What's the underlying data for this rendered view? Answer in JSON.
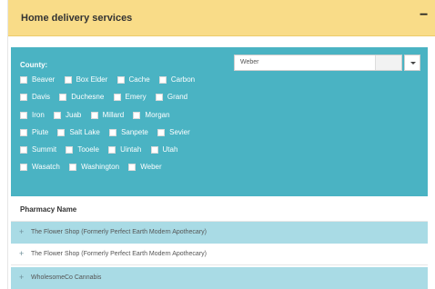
{
  "panel": {
    "title": "Home delivery services",
    "collapse_symbol": "−"
  },
  "filter": {
    "county_label": "County:",
    "select_value": "Weber",
    "dropdown_icon": "caret-down-icon",
    "counties": [
      [
        "Beaver",
        "Box Elder",
        "Cache",
        "Carbon"
      ],
      [
        "Davis",
        "Duchesne",
        "Emery",
        "Grand"
      ],
      [
        "Iron",
        "Juab",
        "Millard",
        "Morgan"
      ],
      [
        "Piute",
        "Salt Lake",
        "Sanpete",
        "Sevier"
      ],
      [
        "Summit",
        "Tooele",
        "Uintah",
        "Utah"
      ],
      [
        "Wasatch",
        "Washington",
        "Weber"
      ]
    ]
  },
  "table": {
    "header": "Pharmacy Name",
    "expand_symbol": "+",
    "rows": [
      "The Flower Shop (Formerly Perfect Earth Modern Apothecary)",
      "The Flower Shop (Formerly Perfect Earth Modern Apothecary)",
      "WholesomeCo Cannabis"
    ]
  },
  "colors": {
    "header_bg": "#f9dc88",
    "filter_bg": "#4ab3c3",
    "row_alt_bg": "#a9dbe5"
  }
}
